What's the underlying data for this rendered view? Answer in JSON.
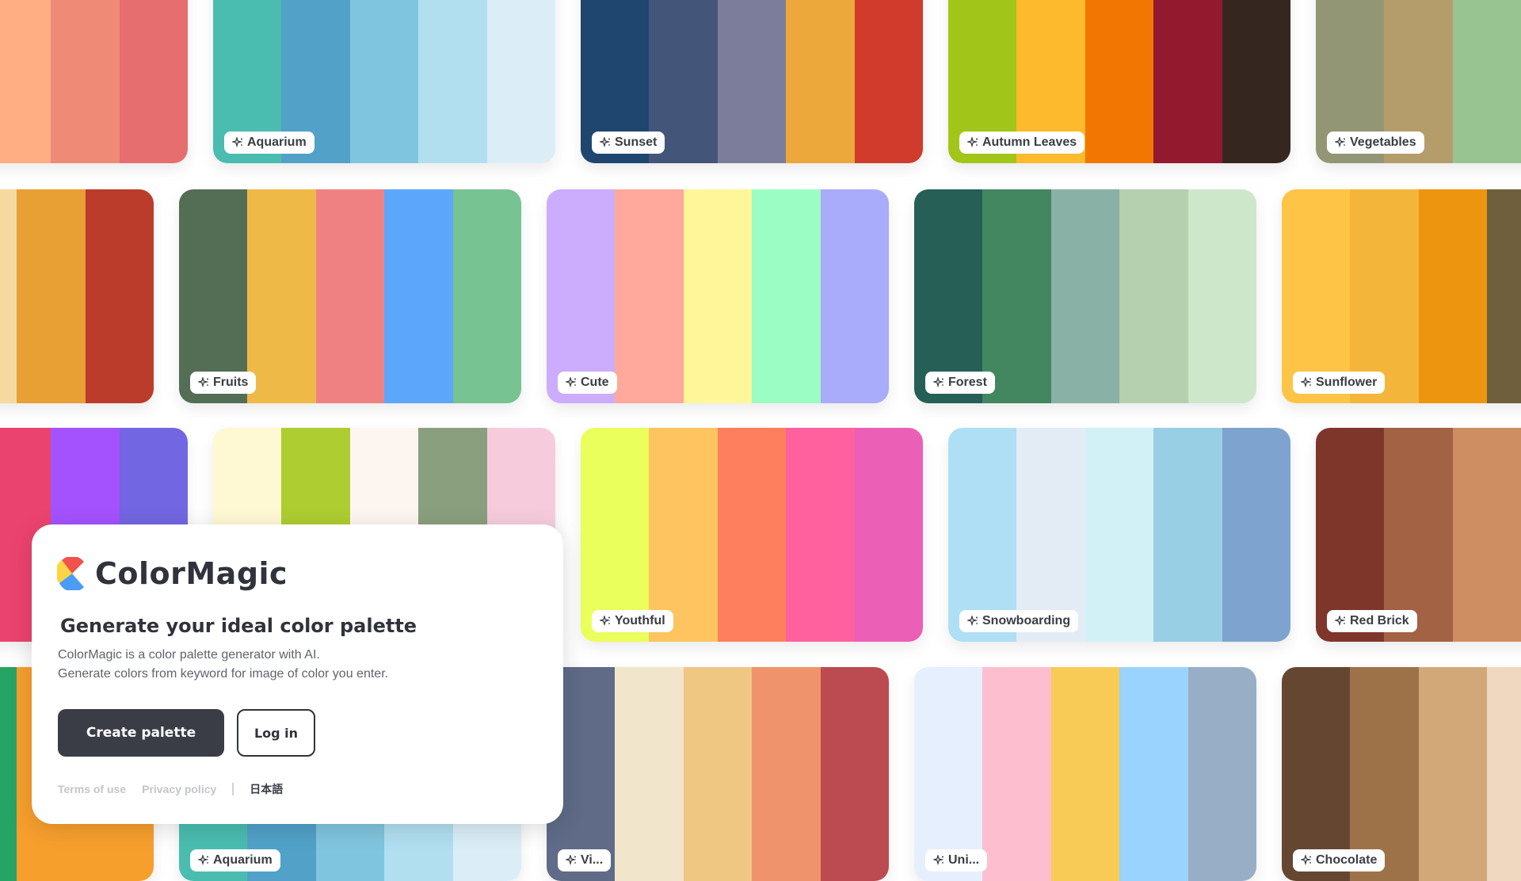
{
  "palettes": [
    {
      "row": 0,
      "col": 0,
      "name": null,
      "colors": [
        "#f4a27a",
        "#ffad82",
        "#ef8a76",
        "#e66e6e"
      ],
      "visible_colors": 3
    },
    {
      "row": 0,
      "col": 1,
      "name": "Aquarium",
      "colors": [
        "#4abdb0",
        "#51a1c8",
        "#80c5df",
        "#b1dff0",
        "#dbeef8"
      ]
    },
    {
      "row": 0,
      "col": 2,
      "name": "Sunset",
      "colors": [
        "#1e466e",
        "#44557a",
        "#7c7c9b",
        "#eca83b",
        "#d13b2b"
      ]
    },
    {
      "row": 0,
      "col": 3,
      "name": "Autumn Leaves",
      "colors": [
        "#a1c518",
        "#fdba2d",
        "#f27602",
        "#931a2e",
        "#35271f"
      ]
    },
    {
      "row": 0,
      "col": 4,
      "name": "Vegetables",
      "colors": [
        "#939675",
        "#b59d6b",
        "#98c491",
        "#98c491",
        "#98c491"
      ]
    },
    {
      "row": 1,
      "col": 0,
      "name": null,
      "colors": [
        "#f5d9a0",
        "#f5d9a0",
        "#e89f34",
        "#bb3c2a"
      ]
    },
    {
      "row": 1,
      "col": 1,
      "name": "Fruits",
      "colors": [
        "#546e55",
        "#eeb947",
        "#f08182",
        "#5ca7fb",
        "#77c391"
      ]
    },
    {
      "row": 1,
      "col": 2,
      "name": "Cute",
      "colors": [
        "#cbacfd",
        "#fea99b",
        "#fff69a",
        "#9bfdc3",
        "#a9abfb"
      ]
    },
    {
      "row": 1,
      "col": 3,
      "name": "Forest",
      "colors": [
        "#255f56",
        "#438761",
        "#89b1a5",
        "#b5d0af",
        "#cde7cb"
      ]
    },
    {
      "row": 1,
      "col": 4,
      "name": "Sunflower",
      "colors": [
        "#fdc446",
        "#f4b63a",
        "#ee950f",
        "#6f5f3c",
        "#6f5f3c"
      ]
    },
    {
      "row": 2,
      "col": 0,
      "name": null,
      "colors": [
        "#eb436f",
        "#eb436f",
        "#a452fd",
        "#7366e2"
      ]
    },
    {
      "row": 2,
      "col": 1,
      "name": null,
      "colors": [
        "#fef8d3",
        "#aecd31",
        "#fdf6f0",
        "#8a9f7e",
        "#f6ccdc"
      ]
    },
    {
      "row": 2,
      "col": 2,
      "name": "Youthful",
      "colors": [
        "#eafe5c",
        "#fec460",
        "#fe7f5d",
        "#fe619e",
        "#ec5fb7"
      ]
    },
    {
      "row": 2,
      "col": 3,
      "name": "Snowboarding",
      "colors": [
        "#aedff4",
        "#e3ecf4",
        "#d1f1f7",
        "#98cfe4",
        "#7ea3cf"
      ]
    },
    {
      "row": 2,
      "col": 4,
      "name": "Red Brick",
      "colors": [
        "#7e362b",
        "#a26243",
        "#ce8e62",
        "#ce8e62",
        "#ce8e62"
      ]
    },
    {
      "row": 3,
      "col": 0,
      "name": null,
      "colors": [
        "#37aaf1",
        "#26a465",
        "#f79f2d",
        "#f79f2d"
      ]
    },
    {
      "row": 3,
      "col": 1,
      "name": "Aquarium",
      "colors": [
        "#4abdb0",
        "#51a1c8",
        "#80c5df",
        "#b1dff0",
        "#dbeef8"
      ]
    },
    {
      "row": 3,
      "col": 2,
      "name": "Vi...",
      "colors": [
        "#5f6b87",
        "#f1e6cb",
        "#f0c683",
        "#ef936c",
        "#bc4b51"
      ]
    },
    {
      "row": 3,
      "col": 3,
      "name": "Uni...",
      "colors": [
        "#e6effd",
        "#fdbfcf",
        "#f8cb56",
        "#9ad3fd",
        "#98aec6"
      ]
    },
    {
      "row": 3,
      "col": 4,
      "name": "Chocolate",
      "colors": [
        "#654731",
        "#9d7249",
        "#d3a878",
        "#f0d8c0",
        "#f0d8c0"
      ]
    }
  ],
  "intro": {
    "brand": "ColorMagic",
    "headline": "Generate your ideal color palette",
    "description_line1": "ColorMagic is a color palette generator with AI.",
    "description_line2": "Generate colors from keyword for image of color you enter.",
    "create_button": "Create palette",
    "login_button": "Log in",
    "footer": {
      "terms": "Terms of use",
      "privacy": "Privacy policy",
      "language": "日本語"
    },
    "logo_colors": {
      "red": "#f0524c",
      "yellow": "#fdd444",
      "blue": "#4a9cf5"
    }
  },
  "icons": {
    "tag_icon": "sparkle-icon"
  }
}
